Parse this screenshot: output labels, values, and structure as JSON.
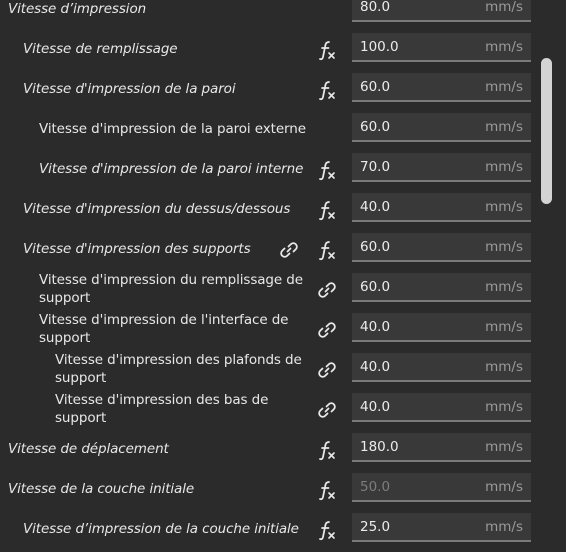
{
  "unit": "mm/s",
  "rows": [
    {
      "label": "Vitesse d’impression",
      "value": "80.0"
    },
    {
      "label": "Vitesse de remplissage",
      "value": "100.0"
    },
    {
      "label": "Vitesse d'impression de la paroi",
      "value": "60.0"
    },
    {
      "label": "Vitesse d'impression de la paroi externe",
      "value": "60.0"
    },
    {
      "label": "Vitesse d'impression de la paroi interne",
      "value": "70.0"
    },
    {
      "label": "Vitesse d'impression du dessus/dessous",
      "value": "40.0"
    },
    {
      "label": "Vitesse d'impression des supports",
      "value": "60.0"
    },
    {
      "label": "Vitesse d'impression du remplissage de support",
      "value": "60.0"
    },
    {
      "label": "Vitesse d'impression de l'interface de support",
      "value": "40.0"
    },
    {
      "label": "Vitesse d'impression des plafonds de support",
      "value": "40.0"
    },
    {
      "label": "Vitesse d'impression des bas de support",
      "value": "40.0"
    },
    {
      "label": "Vitesse de déplacement",
      "value": "180.0"
    },
    {
      "label": "Vitesse de la couche initiale",
      "value": "50.0"
    },
    {
      "label": "Vitesse d’impression de la couche initiale",
      "value": "25.0"
    }
  ],
  "icons": {
    "function": "function-fx-icon",
    "link": "link-chain-icon"
  },
  "colors": {
    "background": "#2b2b2b",
    "field": "#393939",
    "field_border": "#7a7a7a",
    "text": "#e8e8e8",
    "muted_value": "#7d7d7d",
    "scrollbar_thumb": "#d4d4d4"
  }
}
